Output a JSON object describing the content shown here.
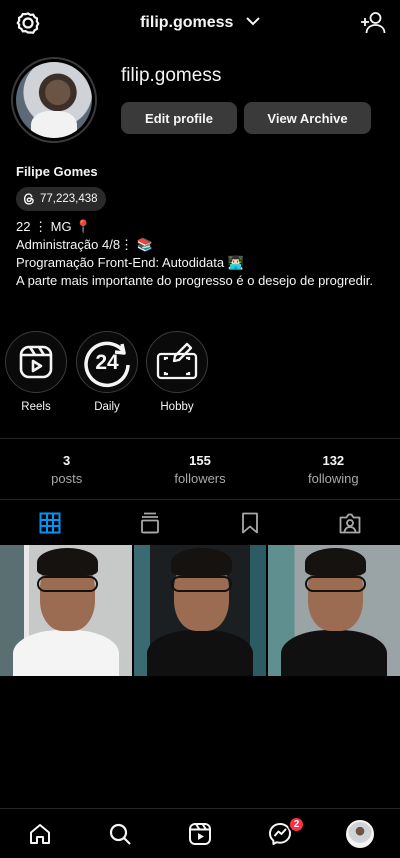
{
  "header": {
    "username": "filip.gomess"
  },
  "profile": {
    "handle": "filip.gomess",
    "edit_label": "Edit profile",
    "archive_label": "View Archive",
    "full_name": "Filipe Gomes",
    "threads_count": "77,223,438",
    "bio": [
      "22 ⋮ MG 📍",
      "Administração 4/8⋮ 📚",
      "Programação Front-End: Autodidata 👨🏻‍💻",
      "A parte mais importante do progresso é o desejo de progredir."
    ]
  },
  "highlights": [
    {
      "label": "Reels",
      "icon": "reels-icon"
    },
    {
      "label": "Daily",
      "icon": "24-hours-icon"
    },
    {
      "label": "Hobby",
      "icon": "drawing-tablet-icon"
    }
  ],
  "stats": [
    {
      "value": "3",
      "label": "posts"
    },
    {
      "value": "155",
      "label": "followers"
    },
    {
      "value": "132",
      "label": "following"
    }
  ],
  "tabs": [
    "grid-icon",
    "feed-icon",
    "saved-icon",
    "tagged-icon"
  ],
  "nav": {
    "messages_badge": "2"
  },
  "colors": {
    "background": "#000000",
    "button": "#3a3a3a",
    "active_tab": "#0095f6",
    "badge": "#ff3040"
  }
}
